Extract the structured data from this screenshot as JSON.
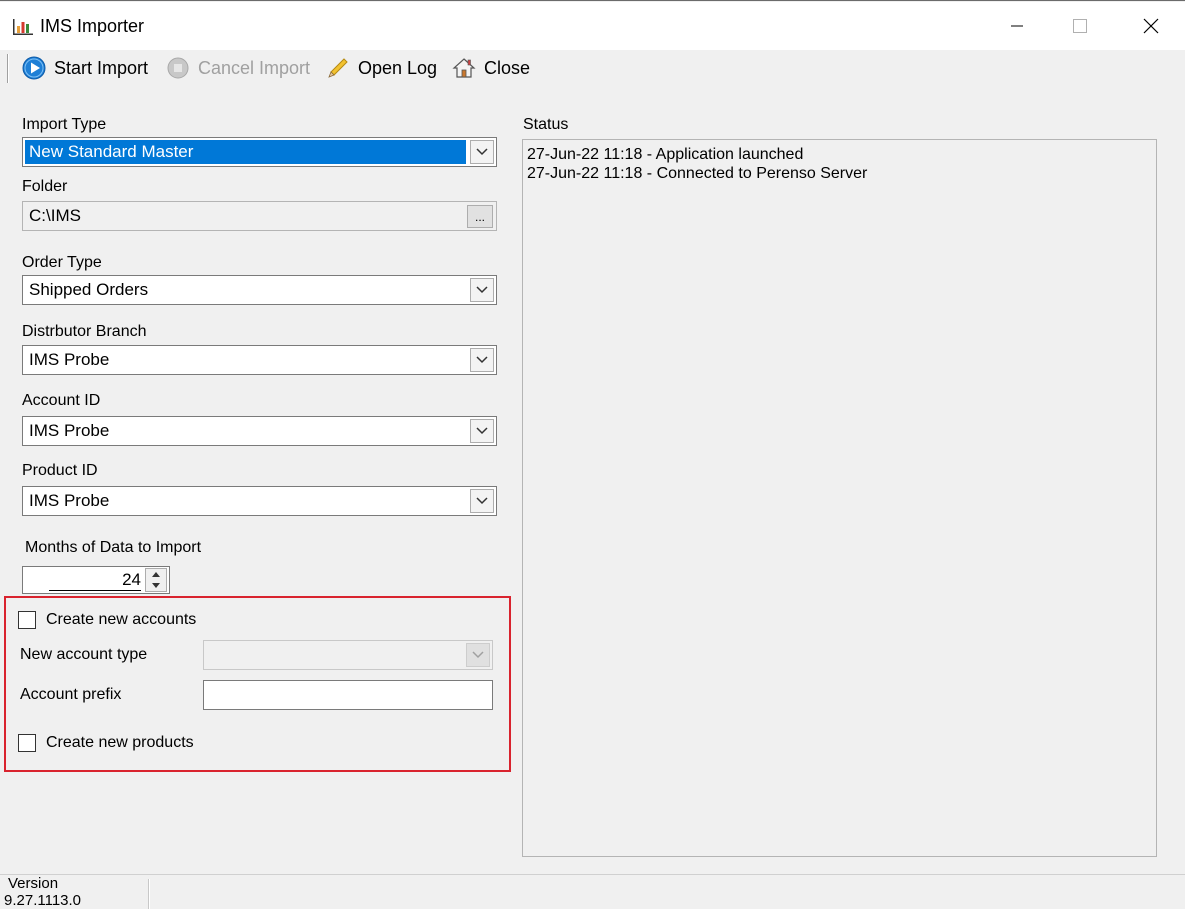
{
  "window": {
    "title": "IMS Importer",
    "icons": {
      "app": "bar-chart-icon",
      "minimize": "minimize-icon",
      "maximize": "maximize-icon",
      "close": "close-icon"
    }
  },
  "toolbar": {
    "start_import": "Start Import",
    "cancel_import": "Cancel Import",
    "open_log": "Open Log",
    "close": "Close",
    "icons": {
      "start": "play-icon",
      "cancel": "stop-icon",
      "log": "pencil-icon",
      "close": "home-icon"
    }
  },
  "form": {
    "import_type": {
      "label": "Import Type",
      "value": "New Standard Master"
    },
    "folder": {
      "label": "Folder",
      "value": "C:\\IMS",
      "browse_label": "..."
    },
    "order_type": {
      "label": "Order Type",
      "value": "Shipped Orders"
    },
    "distributor_branch": {
      "label": "Distrbutor Branch",
      "value": "IMS Probe"
    },
    "account_id": {
      "label": "Account ID",
      "value": "IMS Probe"
    },
    "product_id": {
      "label": "Product ID",
      "value": "IMS Probe"
    },
    "months": {
      "label": "Months of Data to Import",
      "value": "24"
    },
    "create_accounts": {
      "label": "Create new accounts",
      "checked": false
    },
    "new_account_type": {
      "label": "New account type",
      "value": ""
    },
    "account_prefix": {
      "label": "Account prefix",
      "value": ""
    },
    "create_products": {
      "label": "Create new products",
      "checked": false
    }
  },
  "status": {
    "label": "Status",
    "lines": [
      "27-Jun-22 11:18 - Application launched",
      "27-Jun-22 11:18 - Connected to Perenso Server"
    ]
  },
  "statusbar": {
    "version_label": "Version",
    "version_value": "9.27.1113.0"
  },
  "colors": {
    "highlight": "#0078d7",
    "frame": "#d9232e",
    "start_icon": "#1e7fd6"
  }
}
